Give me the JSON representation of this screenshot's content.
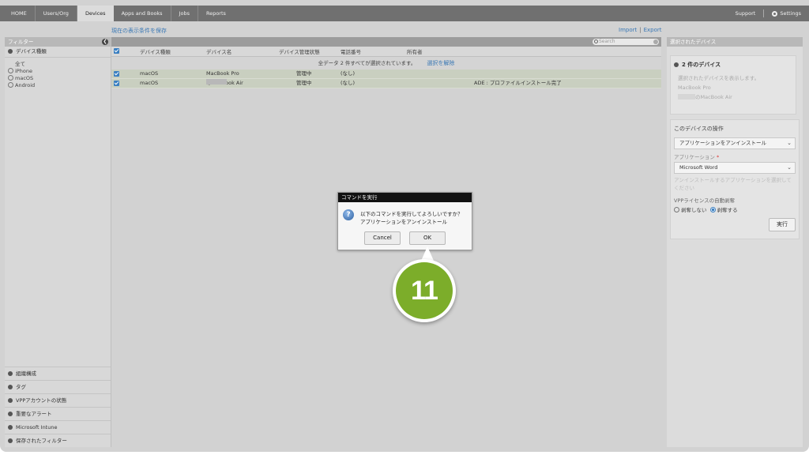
{
  "nav": {
    "items": [
      "HOME",
      "Users/Org",
      "Devices",
      "Apps and Books",
      "Jobs",
      "Reports"
    ],
    "active": "Devices",
    "support": "Support",
    "settings": "Settings"
  },
  "toolbar": {
    "save_conditions": "現在の表示条件を保存",
    "import": "Import",
    "export": "Export",
    "search_placeholder": "Search"
  },
  "filter": {
    "title": "フィルター",
    "device_type_section": "デバイス種類",
    "options": [
      "全て",
      "iPhone",
      "macOS",
      "Android"
    ],
    "bottom_sections": [
      "組織構成",
      "タグ",
      "VPPアカウントの状態",
      "重要なアラート",
      "Microsoft Intune",
      "保存されたフィルター"
    ]
  },
  "table": {
    "columns": [
      "デバイス種類",
      "デバイス名",
      "デバイス管理状態",
      "電話番号",
      "所有者"
    ],
    "selection_info": "全データ 2 件すべてが選択されています。",
    "clear_selection": "選択を解除",
    "rows": [
      {
        "type": "macOS",
        "name": "MacBook Pro",
        "status": "管理中",
        "phone": "(なし)",
        "owner": "",
        "note": ""
      },
      {
        "type": "macOS",
        "name": "のMacBook Air",
        "status": "管理中",
        "phone": "(なし)",
        "owner": "",
        "note": "ADE : プロファイルインストール完了"
      }
    ]
  },
  "right": {
    "title": "選択されたデバイス",
    "count": "2 件のデバイス",
    "show_label": "選択されたデバイスを表示します。",
    "devices": [
      "MacBook Pro",
      "のMacBook Air"
    ],
    "ops_title": "このデバイスの操作",
    "operation": "アプリケーションをアンインストール",
    "app_label": "アプリケーション",
    "app_value": "Microsoft Word",
    "hint": "アンインストールするアプリケーションを選択してください",
    "vpp_label": "VPPライセンスの自動剥奪",
    "radio_no": "剥奪しない",
    "radio_yes": "剥奪する",
    "execute": "実行"
  },
  "dialog": {
    "title": "コマンドを実行",
    "message_line1": "以下のコマンドを実行してよろしいですか？",
    "message_line2": "アプリケーションをアンインストール",
    "cancel": "Cancel",
    "ok": "OK"
  },
  "callout": {
    "number": "11",
    "color": "#7cad2a"
  }
}
